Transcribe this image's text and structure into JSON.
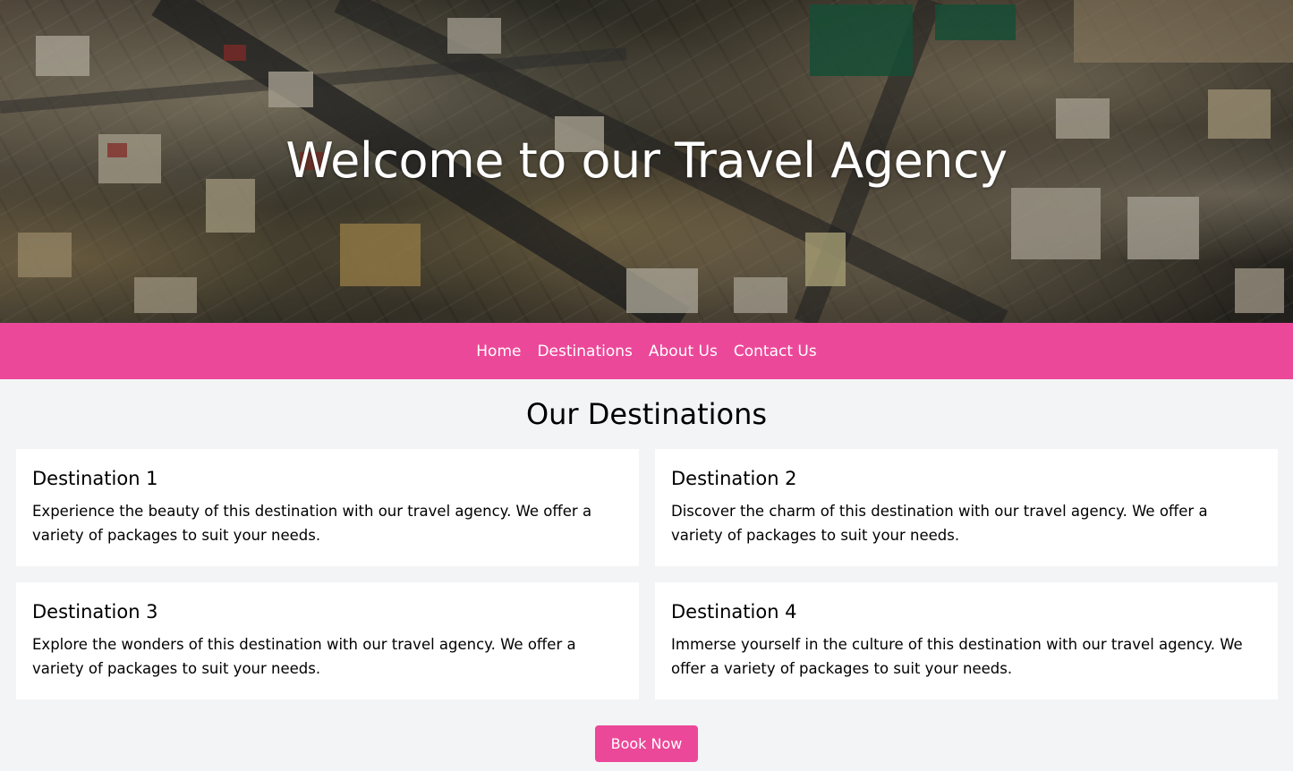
{
  "hero": {
    "title": "Welcome to our Travel Agency"
  },
  "nav": {
    "items": [
      {
        "label": "Home"
      },
      {
        "label": "Destinations"
      },
      {
        "label": "About Us"
      },
      {
        "label": "Contact Us"
      }
    ]
  },
  "destinations": {
    "title": "Our Destinations",
    "cards": [
      {
        "title": "Destination 1",
        "text": "Experience the beauty of this destination with our travel agency. We offer a variety of packages to suit your needs."
      },
      {
        "title": "Destination 2",
        "text": "Discover the charm of this destination with our travel agency. We offer a variety of packages to suit your needs."
      },
      {
        "title": "Destination 3",
        "text": "Explore the wonders of this destination with our travel agency. We offer a variety of packages to suit your needs."
      },
      {
        "title": "Destination 4",
        "text": "Immerse yourself in the culture of this destination with our travel agency. We offer a variety of packages to suit your needs."
      }
    ]
  },
  "cta": {
    "label": "Book Now"
  },
  "colors": {
    "accent": "#ec4899",
    "page_background": "#f3f4f6",
    "card_background": "#ffffff"
  }
}
